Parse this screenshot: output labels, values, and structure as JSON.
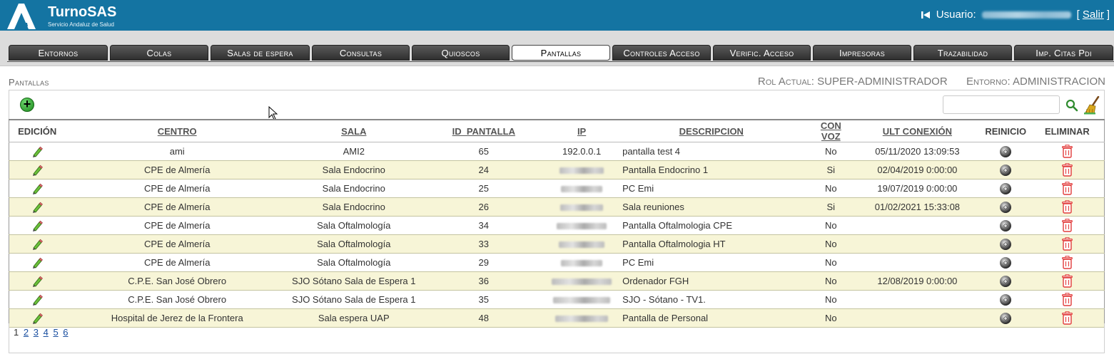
{
  "app": {
    "name": "TurnoSAS",
    "subtitle": "Servicio Andaluz de Salud"
  },
  "user": {
    "label": "Usuario:",
    "logout": "Salir",
    "bracket_open": "[",
    "bracket_close": "]"
  },
  "tabs": [
    {
      "label": "Entornos",
      "active": false
    },
    {
      "label": "Colas",
      "active": false
    },
    {
      "label": "Salas de espera",
      "active": false
    },
    {
      "label": "Consultas",
      "active": false
    },
    {
      "label": "Quioscos",
      "active": false
    },
    {
      "label": "Pantallas",
      "active": true
    },
    {
      "label": "Controles Acceso",
      "active": false
    },
    {
      "label": "Verific. Acceso",
      "active": false
    },
    {
      "label": "Impresoras",
      "active": false
    },
    {
      "label": "Trazabilidad",
      "active": false
    },
    {
      "label": "Imp. Citas Pdi",
      "active": false
    }
  ],
  "page": {
    "title": "Pantallas",
    "rol_label": "Rol Actual:",
    "rol_value": "SUPER-ADMINISTRADOR",
    "entorno_label": "Entorno:",
    "entorno_value": "ADMINISTRACION"
  },
  "toolbar": {
    "add_symbol": "+",
    "search_value": ""
  },
  "table": {
    "columns": [
      "EDICIÓN",
      "CENTRO",
      "SALA",
      "ID_PANTALLA",
      "IP",
      "DESCRIPCION",
      "CON VOZ",
      "ULT CONEXIÓN",
      "REINICIO",
      "ELIMINAR"
    ],
    "rows": [
      {
        "centro": "ami",
        "sala": "AMI2",
        "id": "65",
        "ip": "192.0.0.1",
        "descripcion": "pantalla test 4",
        "voz": "No",
        "conexion": "05/11/2020 13:09:53"
      },
      {
        "centro": "CPE de Almería",
        "sala": "Sala Endocrino",
        "id": "24",
        "ip": "",
        "descripcion": "Pantalla Endocrino 1",
        "voz": "Si",
        "conexion": "02/04/2019 0:00:00"
      },
      {
        "centro": "CPE de Almería",
        "sala": "Sala Endocrino",
        "id": "25",
        "ip": "",
        "descripcion": "PC Emi",
        "voz": "No",
        "conexion": "19/07/2019 0:00:00"
      },
      {
        "centro": "CPE de Almería",
        "sala": "Sala Endocrino",
        "id": "26",
        "ip": "",
        "descripcion": "Sala reuniones",
        "voz": "Si",
        "conexion": "01/02/2021 15:33:08"
      },
      {
        "centro": "CPE de Almería",
        "sala": "Sala Oftalmología",
        "id": "34",
        "ip": "",
        "descripcion": "Pantalla Oftalmologia CPE",
        "voz": "No",
        "conexion": ""
      },
      {
        "centro": "CPE de Almería",
        "sala": "Sala Oftalmología",
        "id": "33",
        "ip": "",
        "descripcion": "Pantalla Oftalmologia HT",
        "voz": "No",
        "conexion": ""
      },
      {
        "centro": "CPE de Almería",
        "sala": "Sala Oftalmología",
        "id": "29",
        "ip": "",
        "descripcion": "PC Emi",
        "voz": "No",
        "conexion": ""
      },
      {
        "centro": "C.P.E. San José Obrero",
        "sala": "SJO Sótano Sala de Espera 1",
        "id": "36",
        "ip": "",
        "descripcion": "Ordenador FGH",
        "voz": "No",
        "conexion": "12/08/2019 0:00:00"
      },
      {
        "centro": "C.P.E. San José Obrero",
        "sala": "SJO Sótano Sala de Espera 1",
        "id": "35",
        "ip": "",
        "descripcion": "SJO - Sótano - TV1.",
        "voz": "No",
        "conexion": ""
      },
      {
        "centro": "Hospital de Jerez de la Frontera",
        "sala": "Sala espera UAP",
        "id": "48",
        "ip": "",
        "descripcion": "Pantalla de Personal",
        "voz": "No",
        "conexion": ""
      }
    ]
  },
  "pager": {
    "current": "1",
    "pages": [
      "2",
      "3",
      "4",
      "5",
      "6"
    ]
  },
  "colors": {
    "header_bg": "#1474a2",
    "row_alt_bg": "#f7f5d7",
    "tab_dark": "#3a3a3a",
    "add_green": "#2fae2f",
    "trash_red": "#e23b3b"
  }
}
